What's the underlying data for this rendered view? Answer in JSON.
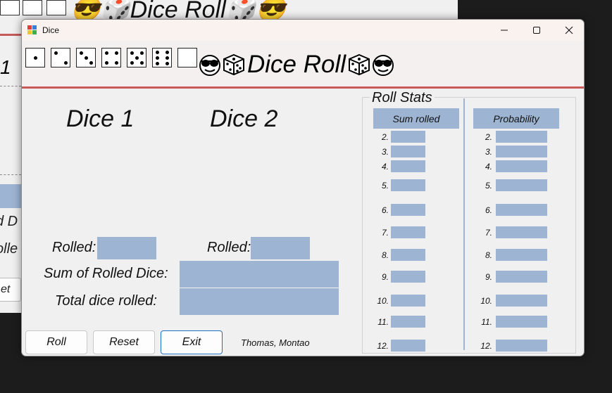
{
  "background_window": {
    "title": "😎🎲Dice Roll🎲😎",
    "partial_texts": [
      "1",
      "d D",
      "olle",
      "et"
    ]
  },
  "window": {
    "title": "Dice",
    "controls": {
      "minimize": "minimize",
      "maximize": "maximize",
      "close": "close"
    }
  },
  "header": {
    "title": "Dice Roll",
    "dice_faces": [
      1,
      2,
      3,
      4,
      5,
      6,
      0
    ],
    "icons": [
      "sunglasses-emoji",
      "die-emoji",
      "die-emoji",
      "sunglasses-emoji"
    ]
  },
  "main": {
    "dice1_label": "Dice 1",
    "dice2_label": "Dice 2",
    "rolled1_label": "Rolled:",
    "rolled2_label": "Rolled:",
    "rolled1_value": "",
    "rolled2_value": "",
    "sum_label": "Sum of Rolled Dice:",
    "sum_value": "",
    "total_label": "Total dice rolled:",
    "total_value": ""
  },
  "buttons": {
    "roll": "Roll",
    "reset": "Reset",
    "exit": "Exit"
  },
  "credit": "Thomas, Montao",
  "stats": {
    "title": "Roll Stats",
    "sum_header": "Sum rolled",
    "prob_header": "Probability",
    "rows": [
      "2.",
      "3.",
      "4.",
      "5.",
      "6.",
      "7.",
      "8.",
      "9.",
      "10.",
      "11.",
      "12."
    ],
    "sum_values": [
      "",
      "",
      "",
      "",
      "",
      "",
      "",
      "",
      "",
      "",
      ""
    ],
    "prob_values": [
      "",
      "",
      "",
      "",
      "",
      "",
      "",
      "",
      "",
      "",
      ""
    ]
  },
  "colors": {
    "field": "#9db5d3",
    "accent_line": "#c85a5a",
    "focus": "#1e6fbf"
  }
}
